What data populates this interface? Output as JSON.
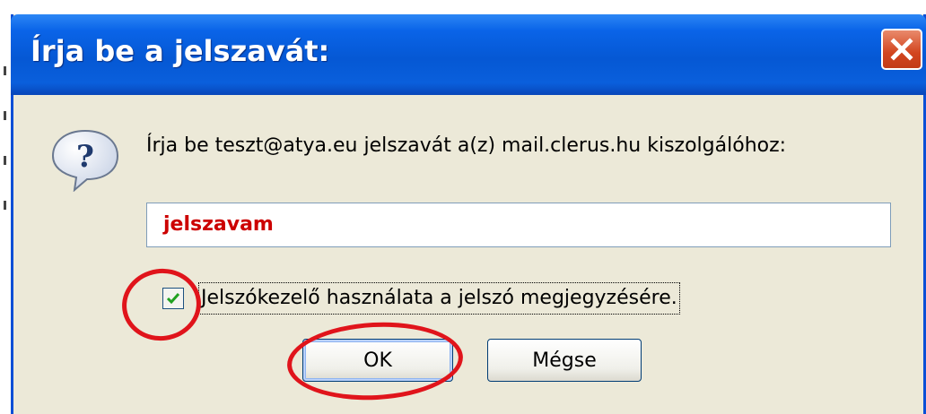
{
  "dialog": {
    "title": "Írja be a jelszavát:",
    "prompt": "Írja be teszt@atya.eu jelszavát a(z) mail.clerus.hu kiszolgálóhoz:",
    "password_value": "jelszavam",
    "remember_label": "Jelszókezelő használata a jelszó megjegyzésére.",
    "remember_checked": true,
    "ok_label": "OK",
    "cancel_label": "Mégse"
  },
  "colors": {
    "titlebar": "#0558d4",
    "close_button": "#d2451f",
    "dialog_face": "#ece9d8",
    "password_text": "#cc0000",
    "annotation_ring": "#e0141b",
    "checkmark": "#21a121"
  },
  "icons": {
    "dialog_icon": "question-balloon-icon",
    "close": "close-x-icon",
    "check": "checkmark-icon"
  }
}
